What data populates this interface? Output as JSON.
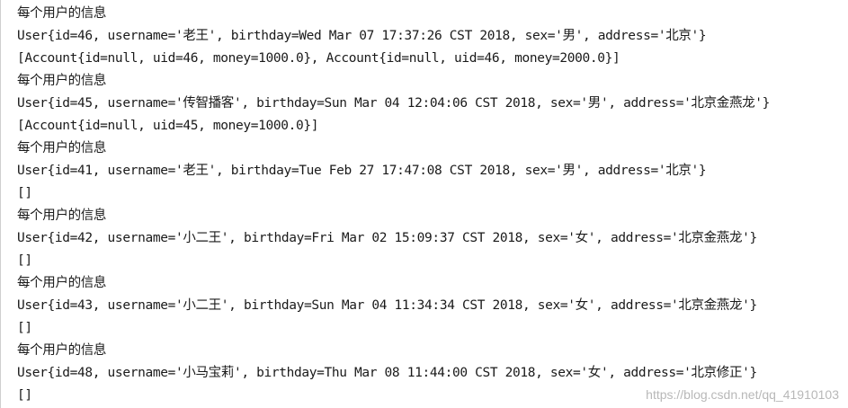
{
  "console": {
    "lines": [
      "每个用户的信息",
      "User{id=46, username='老王', birthday=Wed Mar 07 17:37:26 CST 2018, sex='男', address='北京'}",
      "[Account{id=null, uid=46, money=1000.0}, Account{id=null, uid=46, money=2000.0}]",
      "每个用户的信息",
      "User{id=45, username='传智播客', birthday=Sun Mar 04 12:04:06 CST 2018, sex='男', address='北京金燕龙'}",
      "[Account{id=null, uid=45, money=1000.0}]",
      "每个用户的信息",
      "User{id=41, username='老王', birthday=Tue Feb 27 17:47:08 CST 2018, sex='男', address='北京'}",
      "[]",
      "每个用户的信息",
      "User{id=42, username='小二王', birthday=Fri Mar 02 15:09:37 CST 2018, sex='女', address='北京金燕龙'}",
      "[]",
      "每个用户的信息",
      "User{id=43, username='小二王', birthday=Sun Mar 04 11:34:34 CST 2018, sex='女', address='北京金燕龙'}",
      "[]",
      "每个用户的信息",
      "User{id=48, username='小马宝莉', birthday=Thu Mar 08 11:44:00 CST 2018, sex='女', address='北京修正'}",
      "[]"
    ]
  },
  "watermark": "https://blog.csdn.net/qq_41910103"
}
